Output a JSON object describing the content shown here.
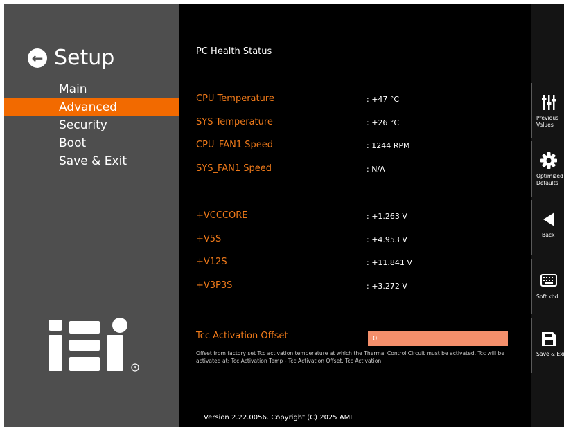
{
  "window": {
    "title": "Setup"
  },
  "menu": {
    "items": [
      {
        "label": "Main"
      },
      {
        "label": "Advanced",
        "active": true
      },
      {
        "label": "Security"
      },
      {
        "label": "Boot"
      },
      {
        "label": "Save & Exit"
      }
    ]
  },
  "main": {
    "title": "PC Health Status",
    "readings": [
      {
        "label": "CPU Temperature",
        "value": ": +47 °C"
      },
      {
        "label": "SYS Temperature",
        "value": ": +26 °C"
      },
      {
        "label": "CPU_FAN1 Speed",
        "value": ": 1244 RPM"
      },
      {
        "label": "SYS_FAN1 Speed",
        "value": ": N/A"
      },
      {
        "label": "+VCCCORE",
        "value": ": +1.263 V"
      },
      {
        "label": "+V5S",
        "value": ": +4.953 V"
      },
      {
        "label": "+V12S",
        "value": ": +11.841 V"
      },
      {
        "label": "+V3P3S",
        "value": ": +3.272 V"
      }
    ],
    "tcc": {
      "label": "Tcc Activation Offset",
      "value": "0"
    },
    "help": "Offset from factory set Tcc activation temperature at which the Thermal Control Circuit must be activated. Tcc will be activated at: Tcc Activation Temp - Tcc Activation Offset. Tcc Activation",
    "version": "Version 2.22.0056. Copyright (C) 2025 AMI"
  },
  "rightbar": {
    "buttons": [
      {
        "label": "Previous\nValues",
        "icon": "sliders-icon"
      },
      {
        "label": "Optimized\nDefaults",
        "icon": "gear-icon"
      },
      {
        "label": "Back",
        "icon": "back-triangle-icon"
      },
      {
        "label": "Soft kbd",
        "icon": "keyboard-icon"
      },
      {
        "label": "Save & Exit",
        "icon": "save-icon"
      }
    ]
  },
  "logo": {
    "text": "iEi",
    "mark": "®"
  },
  "colors": {
    "accent": "#f26a00",
    "label": "#f07a1a",
    "input": "#f48f6b",
    "sidebar": "#4e4e4e",
    "background": "#000000"
  }
}
